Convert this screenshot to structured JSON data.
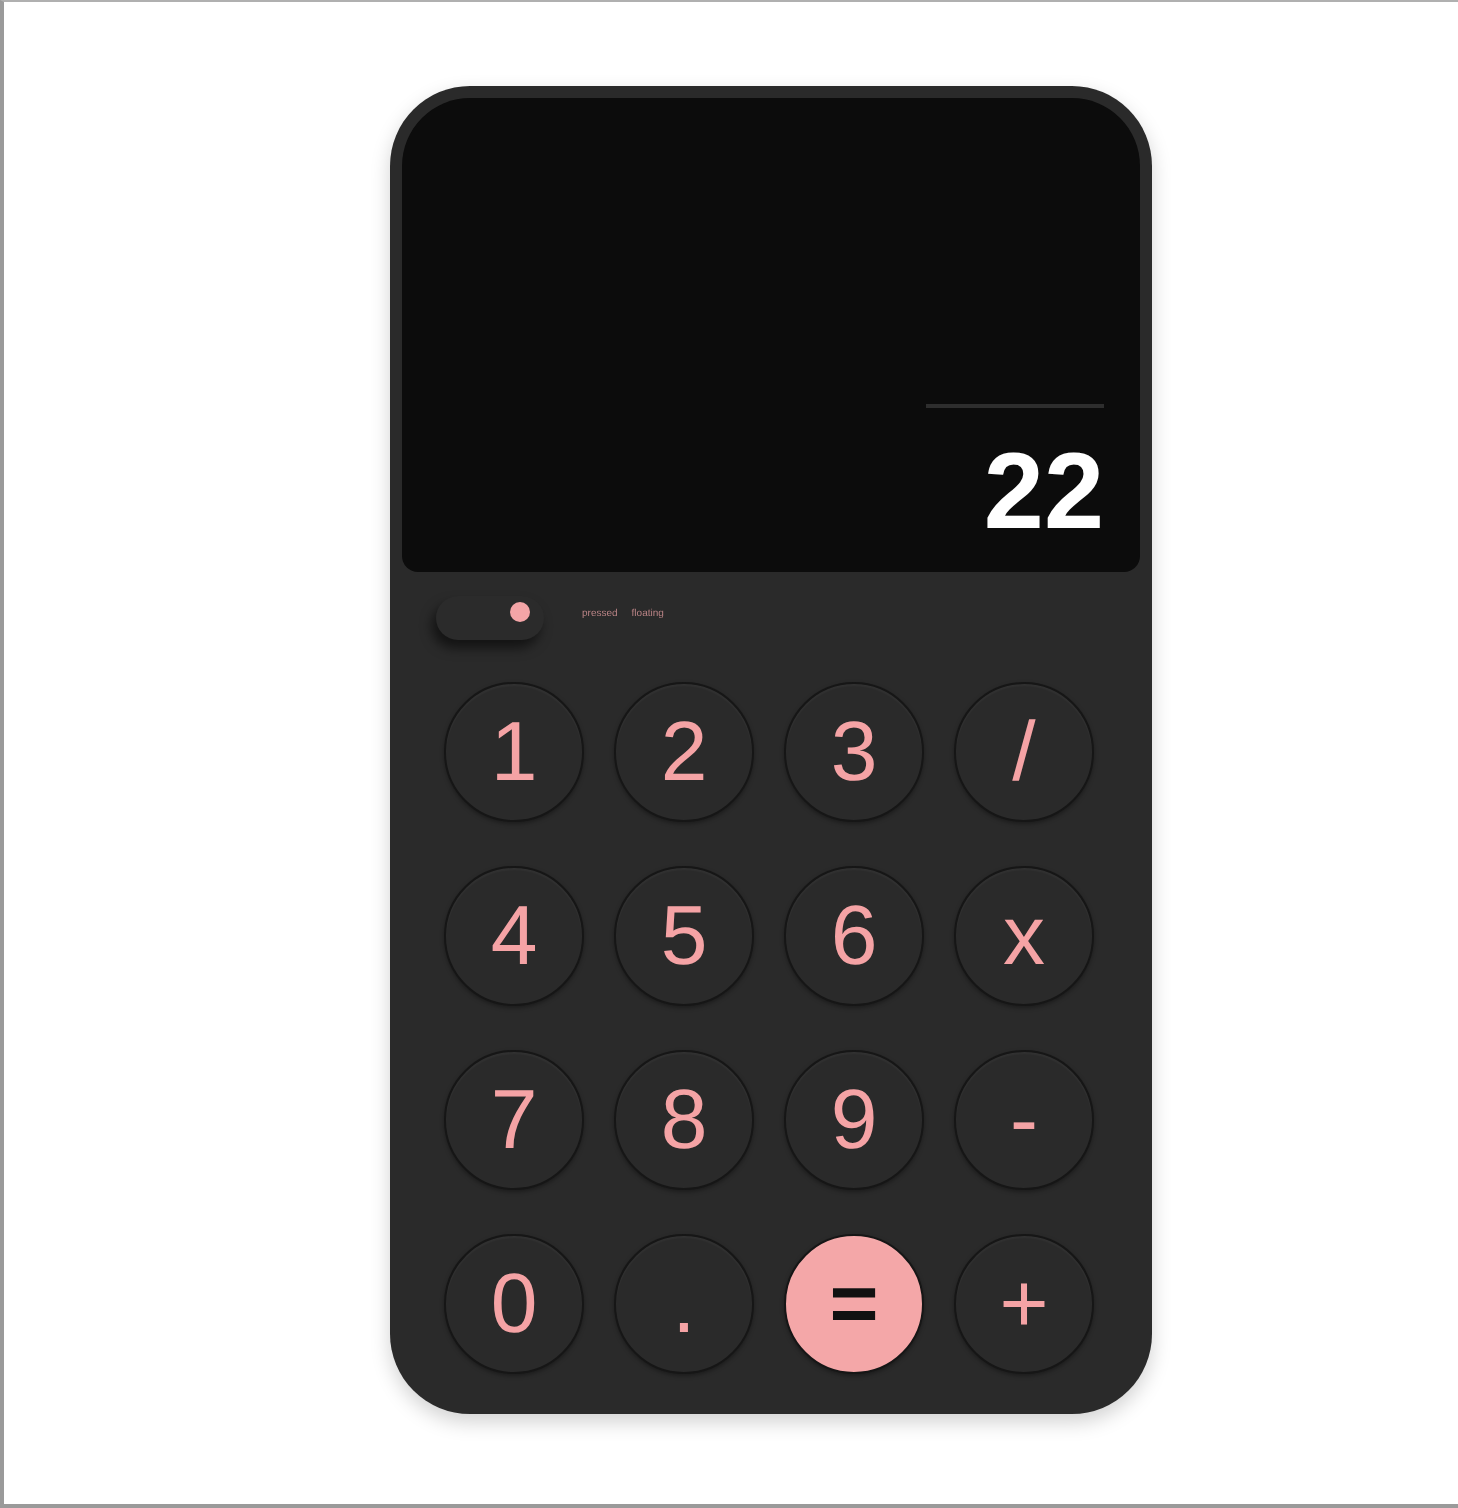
{
  "display": {
    "value": "22"
  },
  "mode_toggle": {
    "on": true
  },
  "mode_labels": [
    "pressed",
    "floating"
  ],
  "keys": [
    {
      "label": "1",
      "kind": "key"
    },
    {
      "label": "2",
      "kind": "key"
    },
    {
      "label": "3",
      "kind": "key"
    },
    {
      "label": "/",
      "kind": "key"
    },
    {
      "label": "4",
      "kind": "key"
    },
    {
      "label": "5",
      "kind": "key"
    },
    {
      "label": "6",
      "kind": "key"
    },
    {
      "label": "x",
      "kind": "key"
    },
    {
      "label": "7",
      "kind": "key"
    },
    {
      "label": "8",
      "kind": "key"
    },
    {
      "label": "9",
      "kind": "key"
    },
    {
      "label": "-",
      "kind": "key"
    },
    {
      "label": "0",
      "kind": "key"
    },
    {
      "label": ".",
      "kind": "key"
    },
    {
      "label": "=",
      "kind": "equals"
    },
    {
      "label": "+",
      "kind": "key"
    }
  ]
}
